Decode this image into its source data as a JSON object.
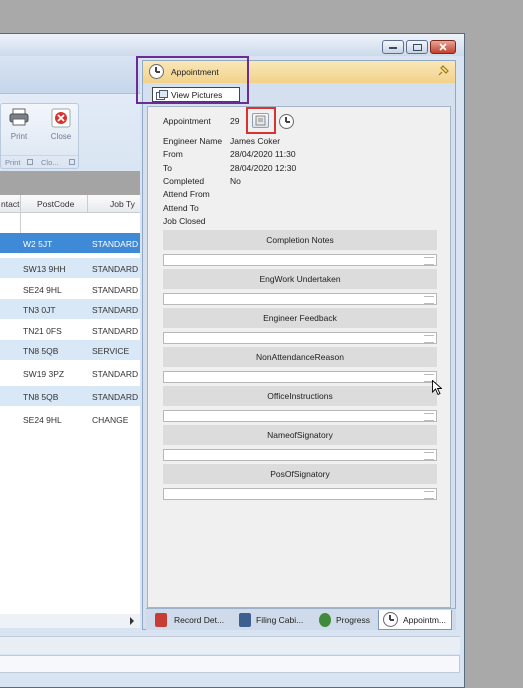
{
  "ribbon": {
    "print_label": "Print",
    "close_label": "Close",
    "group_print": "Print",
    "group_close": "Clo..."
  },
  "grid": {
    "headers": [
      "ntact",
      "PostCode",
      "Job Ty"
    ],
    "rows": [
      {
        "postcode": "W2 5JT",
        "jobtype": "STANDARD"
      },
      {
        "postcode": "SW13 9HH",
        "jobtype": "STANDARD"
      },
      {
        "postcode": "SE24 9HL",
        "jobtype": "STANDARD"
      },
      {
        "postcode": "TN3 0JT",
        "jobtype": "STANDARD"
      },
      {
        "postcode": "TN21 0FS",
        "jobtype": "STANDARD"
      },
      {
        "postcode": "TN8 5QB",
        "jobtype": "SERVICE"
      },
      {
        "postcode": "SW19 3PZ",
        "jobtype": "STANDARD"
      },
      {
        "postcode": "TN8 5QB",
        "jobtype": "STANDARD"
      },
      {
        "postcode": "SE24 9HL",
        "jobtype": "CHANGE"
      }
    ]
  },
  "dock": {
    "title": "Appointment",
    "view_pictures": "View Pictures"
  },
  "fields": {
    "appointment_label": "Appointment",
    "appointment_value": "29",
    "engineer_label": "Engineer Name",
    "engineer_value": "James Coker",
    "from_label": "From",
    "from_value": "28/04/2020 11:30",
    "to_label": "To",
    "to_value": "28/04/2020 12:30",
    "completed_label": "Completed",
    "completed_value": "No",
    "attend_from_label": "Attend From",
    "attend_to_label": "Attend To",
    "job_closed_label": "Job Closed"
  },
  "sections": [
    "Completion Notes",
    "EngWork Undertaken",
    "Engineer Feedback",
    "NonAttendanceReason",
    "OfficeInstructions",
    "NameofSignatory",
    "PosOfSignatory"
  ],
  "tabs": {
    "record": "Record Det...",
    "filing": "Filing Cabi...",
    "progress": "Progress",
    "appointment": "Appointm..."
  },
  "colors": {
    "selected_row": "#3f8ad6",
    "alt_row": "#d9e8f6",
    "purple_highlight": "#6a2d93",
    "red_highlight": "#d8332e",
    "dock_header": "#f2d28a"
  }
}
